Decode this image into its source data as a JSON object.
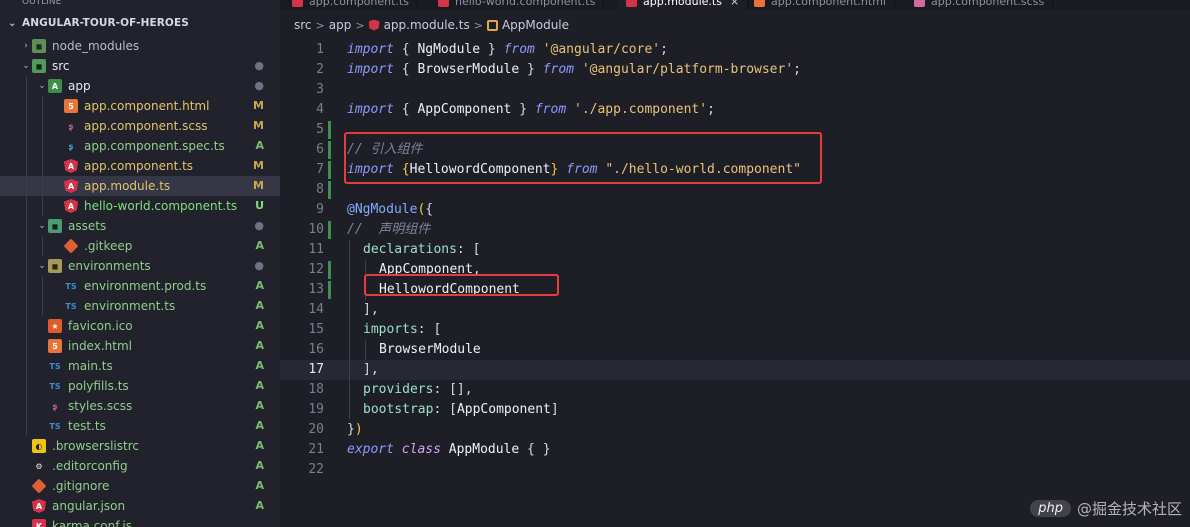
{
  "sidebar": {
    "title_strip": "OUTLINE",
    "root": "ANGULAR-TOUR-OF-HEROES",
    "rows": [
      {
        "name": "node_modules",
        "depth": 1,
        "arrow": "›",
        "icon": "ic-folder-node",
        "glyph": "◼",
        "color": "#b8bbcc",
        "status": "",
        "status_color": "",
        "selected": false,
        "icon_name": "node-modules-folder-icon"
      },
      {
        "name": "src",
        "depth": 1,
        "arrow": "⌄",
        "icon": "ic-folder-src",
        "glyph": "◼",
        "color": "#e6e8f2",
        "status": "●",
        "status_color": "#6f7285",
        "selected": false,
        "icon_name": "src-folder-icon"
      },
      {
        "name": "app",
        "depth": 2,
        "arrow": "⌄",
        "icon": "ic-folder-app",
        "glyph": "A",
        "color": "#e6e8f2",
        "status": "●",
        "status_color": "#6f7285",
        "selected": false,
        "icon_name": "app-folder-icon"
      },
      {
        "name": "app.component.html",
        "depth": 3,
        "arrow": "",
        "icon": "ic-html",
        "glyph": "5",
        "color": "#e3c46a",
        "status": "M",
        "status_color": "#c9a94a",
        "selected": false,
        "icon_name": "html-file-icon"
      },
      {
        "name": "app.component.scss",
        "depth": 3,
        "arrow": "",
        "icon": "ic-scss",
        "glyph": "ʂ",
        "color": "#e3c46a",
        "status": "M",
        "status_color": "#c9a94a",
        "selected": false,
        "icon_name": "scss-file-icon"
      },
      {
        "name": "app.component.spec.ts",
        "depth": 3,
        "arrow": "",
        "icon": "ic-spec",
        "glyph": "ʂ",
        "color": "#8fcf8a",
        "status": "A",
        "status_color": "#7cbf74",
        "selected": false,
        "icon_name": "spec-file-icon"
      },
      {
        "name": "app.component.ts",
        "depth": 3,
        "arrow": "",
        "icon": "ic-ng",
        "glyph": "A",
        "color": "#e3c46a",
        "status": "M",
        "status_color": "#c9a94a",
        "selected": false,
        "icon_name": "angular-file-icon"
      },
      {
        "name": "app.module.ts",
        "depth": 3,
        "arrow": "",
        "icon": "ic-ng",
        "glyph": "A",
        "color": "#e3c46a",
        "status": "M",
        "status_color": "#c9a94a",
        "selected": true,
        "icon_name": "angular-file-icon"
      },
      {
        "name": "hello-world.component.ts",
        "depth": 3,
        "arrow": "",
        "icon": "ic-ng",
        "glyph": "A",
        "color": "#7fe07b",
        "status": "U",
        "status_color": "#7fe07b",
        "selected": false,
        "icon_name": "angular-file-icon"
      },
      {
        "name": "assets",
        "depth": 2,
        "arrow": "⌄",
        "icon": "ic-folder-assets",
        "glyph": "◼",
        "color": "#8fcf8a",
        "status": "●",
        "status_color": "#6f7285",
        "selected": false,
        "icon_name": "assets-folder-icon"
      },
      {
        "name": ".gitkeep",
        "depth": 3,
        "arrow": "",
        "icon": "ic-git",
        "glyph": "",
        "color": "#8fcf8a",
        "status": "A",
        "status_color": "#7cbf74",
        "selected": false,
        "icon_name": "git-file-icon"
      },
      {
        "name": "environments",
        "depth": 2,
        "arrow": "⌄",
        "icon": "ic-folder-env",
        "glyph": "◼",
        "color": "#8fcf8a",
        "status": "●",
        "status_color": "#6f7285",
        "selected": false,
        "icon_name": "environments-folder-icon"
      },
      {
        "name": "environment.prod.ts",
        "depth": 3,
        "arrow": "",
        "icon": "ic-ts",
        "glyph": "TS",
        "color": "#8fcf8a",
        "status": "A",
        "status_color": "#7cbf74",
        "selected": false,
        "icon_name": "typescript-file-icon"
      },
      {
        "name": "environment.ts",
        "depth": 3,
        "arrow": "",
        "icon": "ic-ts",
        "glyph": "TS",
        "color": "#8fcf8a",
        "status": "A",
        "status_color": "#7cbf74",
        "selected": false,
        "icon_name": "typescript-file-icon"
      },
      {
        "name": "favicon.ico",
        "depth": 2,
        "arrow": "",
        "icon": "ic-fav",
        "glyph": "★",
        "color": "#8fcf8a",
        "status": "A",
        "status_color": "#7cbf74",
        "selected": false,
        "icon_name": "favicon-file-icon"
      },
      {
        "name": "index.html",
        "depth": 2,
        "arrow": "",
        "icon": "ic-html",
        "glyph": "5",
        "color": "#8fcf8a",
        "status": "A",
        "status_color": "#7cbf74",
        "selected": false,
        "icon_name": "html-file-icon"
      },
      {
        "name": "main.ts",
        "depth": 2,
        "arrow": "",
        "icon": "ic-ts",
        "glyph": "TS",
        "color": "#8fcf8a",
        "status": "A",
        "status_color": "#7cbf74",
        "selected": false,
        "icon_name": "typescript-file-icon"
      },
      {
        "name": "polyfills.ts",
        "depth": 2,
        "arrow": "",
        "icon": "ic-ts",
        "glyph": "TS",
        "color": "#8fcf8a",
        "status": "A",
        "status_color": "#7cbf74",
        "selected": false,
        "icon_name": "typescript-file-icon"
      },
      {
        "name": "styles.scss",
        "depth": 2,
        "arrow": "",
        "icon": "ic-scss",
        "glyph": "ʂ",
        "color": "#8fcf8a",
        "status": "A",
        "status_color": "#7cbf74",
        "selected": false,
        "icon_name": "scss-file-icon"
      },
      {
        "name": "test.ts",
        "depth": 2,
        "arrow": "",
        "icon": "ic-ts",
        "glyph": "TS",
        "color": "#8fcf8a",
        "status": "A",
        "status_color": "#7cbf74",
        "selected": false,
        "icon_name": "typescript-file-icon"
      },
      {
        "name": ".browserslistrc",
        "depth": 1,
        "arrow": "",
        "icon": "ic-brow",
        "glyph": "◐",
        "color": "#8fcf8a",
        "status": "A",
        "status_color": "#7cbf74",
        "selected": false,
        "icon_name": "browserslist-file-icon"
      },
      {
        "name": ".editorconfig",
        "depth": 1,
        "arrow": "",
        "icon": "ic-edit",
        "glyph": "⚙",
        "color": "#8fcf8a",
        "status": "A",
        "status_color": "#7cbf74",
        "selected": false,
        "icon_name": "editorconfig-file-icon"
      },
      {
        "name": ".gitignore",
        "depth": 1,
        "arrow": "",
        "icon": "ic-git",
        "glyph": "",
        "color": "#8fcf8a",
        "status": "A",
        "status_color": "#7cbf74",
        "selected": false,
        "icon_name": "git-file-icon"
      },
      {
        "name": "angular.json",
        "depth": 1,
        "arrow": "",
        "icon": "ic-json",
        "glyph": "A",
        "color": "#8fcf8a",
        "status": "A",
        "status_color": "#7cbf74",
        "selected": false,
        "icon_name": "angular-json-file-icon"
      },
      {
        "name": "karma.conf.js",
        "depth": 1,
        "arrow": "",
        "icon": "ic-karma",
        "glyph": "K",
        "color": "#8fcf8a",
        "status": "",
        "status_color": "",
        "selected": false,
        "icon_name": "karma-file-icon"
      }
    ]
  },
  "tabs": [
    {
      "label": "app.component.ts",
      "icon_color": "#d4344a",
      "active": false,
      "close": ""
    },
    {
      "label": "hello-world.component.ts",
      "icon_color": "#d4344a",
      "active": false,
      "close": ""
    },
    {
      "label": "app.module.ts",
      "icon_color": "#d4344a",
      "active": true,
      "close": "×"
    },
    {
      "label": "app.component.html",
      "icon_color": "#e8743a",
      "active": false,
      "close": ""
    },
    {
      "label": "app.component.scss",
      "icon_color": "#d06aa3",
      "active": false,
      "close": ""
    }
  ],
  "breadcrumb": {
    "items": [
      "src",
      "app",
      "app.module.ts",
      "AppModule"
    ],
    "separator": ">"
  },
  "code": {
    "current_line": 17,
    "lines": [
      {
        "n": "1",
        "mod": false,
        "indent": 0,
        "tokens": [
          [
            "kw",
            "import"
          ],
          [
            "pun",
            " { "
          ],
          [
            "id",
            "NgModule"
          ],
          [
            "pun",
            " } "
          ],
          [
            "kw",
            "from"
          ],
          [
            "pun",
            " "
          ],
          [
            "str",
            "'@angular/core'"
          ],
          [
            "pun",
            ";"
          ]
        ]
      },
      {
        "n": "2",
        "mod": false,
        "indent": 0,
        "tokens": [
          [
            "kw",
            "import"
          ],
          [
            "pun",
            " { "
          ],
          [
            "id",
            "BrowserModule"
          ],
          [
            "pun",
            " } "
          ],
          [
            "kw",
            "from"
          ],
          [
            "pun",
            " "
          ],
          [
            "str",
            "'@angular/platform-browser'"
          ],
          [
            "pun",
            ";"
          ]
        ]
      },
      {
        "n": "3",
        "mod": false,
        "indent": 0,
        "tokens": []
      },
      {
        "n": "4",
        "mod": false,
        "indent": 0,
        "tokens": [
          [
            "kw",
            "import"
          ],
          [
            "pun",
            " { "
          ],
          [
            "id",
            "AppComponent"
          ],
          [
            "pun",
            " } "
          ],
          [
            "kw",
            "from"
          ],
          [
            "pun",
            " "
          ],
          [
            "str",
            "'./app.component'"
          ],
          [
            "pun",
            ";"
          ]
        ]
      },
      {
        "n": "5",
        "mod": true,
        "indent": 0,
        "tokens": []
      },
      {
        "n": "6",
        "mod": true,
        "indent": 0,
        "tokens": [
          [
            "cm",
            "// 引入组件"
          ]
        ]
      },
      {
        "n": "7",
        "mod": true,
        "indent": 0,
        "tokens": [
          [
            "kw",
            "import"
          ],
          [
            "pun",
            " "
          ],
          [
            "brk",
            "{"
          ],
          [
            "id",
            "HellowordComponent"
          ],
          [
            "brk",
            "}"
          ],
          [
            "pun",
            " "
          ],
          [
            "kw",
            "from"
          ],
          [
            "pun",
            " "
          ],
          [
            "str",
            "\"./hello-world.component\""
          ]
        ]
      },
      {
        "n": "8",
        "mod": true,
        "indent": 0,
        "tokens": []
      },
      {
        "n": "9",
        "mod": false,
        "indent": 0,
        "tokens": [
          [
            "dec",
            "@NgModule"
          ],
          [
            "brk",
            "("
          ],
          [
            "pun",
            "{"
          ]
        ]
      },
      {
        "n": "10",
        "mod": true,
        "indent": 0,
        "tokens": [
          [
            "cm",
            "//  声明组件"
          ]
        ]
      },
      {
        "n": "11",
        "mod": false,
        "indent": 1,
        "tokens": [
          [
            "prop",
            "declarations"
          ],
          [
            "pun",
            ": ["
          ]
        ]
      },
      {
        "n": "12",
        "mod": true,
        "indent": 2,
        "tokens": [
          [
            "id",
            "AppComponent"
          ],
          [
            "pun",
            ","
          ]
        ]
      },
      {
        "n": "13",
        "mod": true,
        "indent": 2,
        "tokens": [
          [
            "id",
            "HellowordComponent"
          ]
        ]
      },
      {
        "n": "14",
        "mod": false,
        "indent": 1,
        "tokens": [
          [
            "pun",
            "],"
          ]
        ]
      },
      {
        "n": "15",
        "mod": false,
        "indent": 1,
        "tokens": [
          [
            "prop",
            "imports"
          ],
          [
            "pun",
            ": ["
          ]
        ]
      },
      {
        "n": "16",
        "mod": false,
        "indent": 2,
        "tokens": [
          [
            "id",
            "BrowserModule"
          ]
        ]
      },
      {
        "n": "17",
        "mod": false,
        "indent": 1,
        "tokens": [
          [
            "pun",
            "],"
          ]
        ]
      },
      {
        "n": "18",
        "mod": false,
        "indent": 1,
        "tokens": [
          [
            "prop",
            "providers"
          ],
          [
            "pun",
            ": [],"
          ]
        ]
      },
      {
        "n": "19",
        "mod": false,
        "indent": 1,
        "tokens": [
          [
            "prop",
            "bootstrap"
          ],
          [
            "pun",
            ": ["
          ],
          [
            "id",
            "AppComponent"
          ],
          [
            "pun",
            "]"
          ]
        ]
      },
      {
        "n": "20",
        "mod": false,
        "indent": 0,
        "tokens": [
          [
            "pun",
            "}"
          ],
          [
            "brk",
            ")"
          ]
        ]
      },
      {
        "n": "21",
        "mod": false,
        "indent": 0,
        "tokens": [
          [
            "kw",
            "export"
          ],
          [
            "pun",
            " "
          ],
          [
            "kwc",
            "class"
          ],
          [
            "pun",
            " "
          ],
          [
            "id",
            "AppModule"
          ],
          [
            "pun",
            " { }"
          ]
        ]
      },
      {
        "n": "22",
        "mod": false,
        "indent": 0,
        "tokens": []
      }
    ]
  },
  "watermark": {
    "badge": "php",
    "text": "@掘金技术社区"
  },
  "colors": {
    "accent_red": "#e53d3d",
    "modified_gutter": "#3d8f53"
  }
}
